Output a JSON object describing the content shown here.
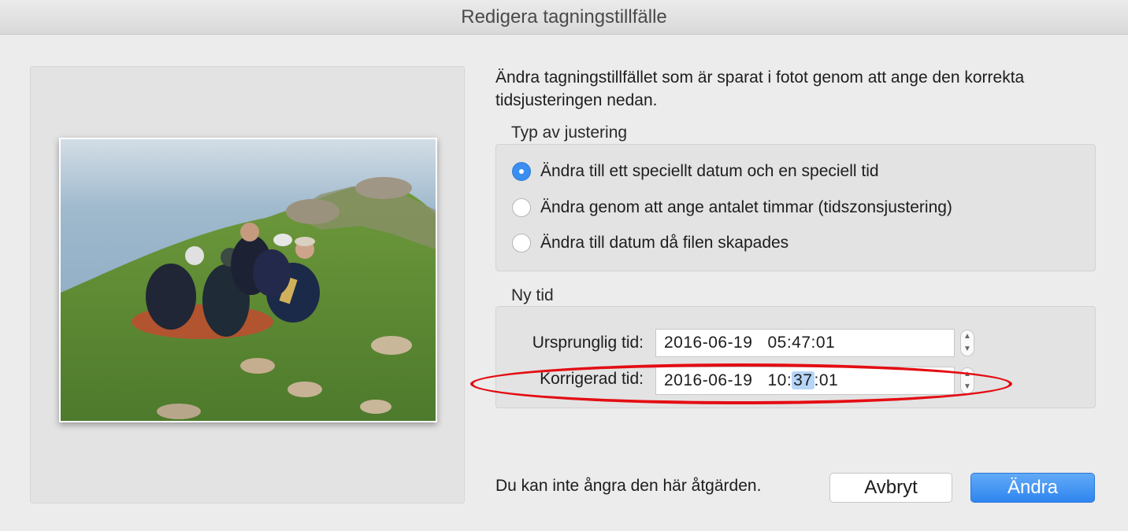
{
  "window": {
    "title": "Redigera tagningstillfälle"
  },
  "description": "Ändra tagningstillfället som är sparat i fotot genom att ange den korrekta tidsjusteringen nedan.",
  "adjustment": {
    "label": "Typ av justering",
    "options": [
      {
        "label": "Ändra till ett speciellt datum och en speciell tid",
        "selected": true
      },
      {
        "label": "Ändra genom att ange antalet timmar (tidszonsjustering)",
        "selected": false
      },
      {
        "label": "Ändra till datum då filen skapades",
        "selected": false
      }
    ]
  },
  "new_time": {
    "label": "Ny tid",
    "original": {
      "label": "Ursprunglig tid:",
      "date": "2016-06-19",
      "hour": "05",
      "minute": "47",
      "second": "01"
    },
    "corrected": {
      "label": "Korrigerad tid:",
      "date": "2016-06-19",
      "hour": "10",
      "minute": "37",
      "second": "01"
    }
  },
  "footer": {
    "warning": "Du kan inte ångra den här åtgärden.",
    "cancel_label": "Avbryt",
    "ok_label": "Ändra"
  },
  "colors": {
    "accent": "#3b8ef0",
    "annotation": "#e40d13",
    "selection": "#b6d5f7"
  }
}
